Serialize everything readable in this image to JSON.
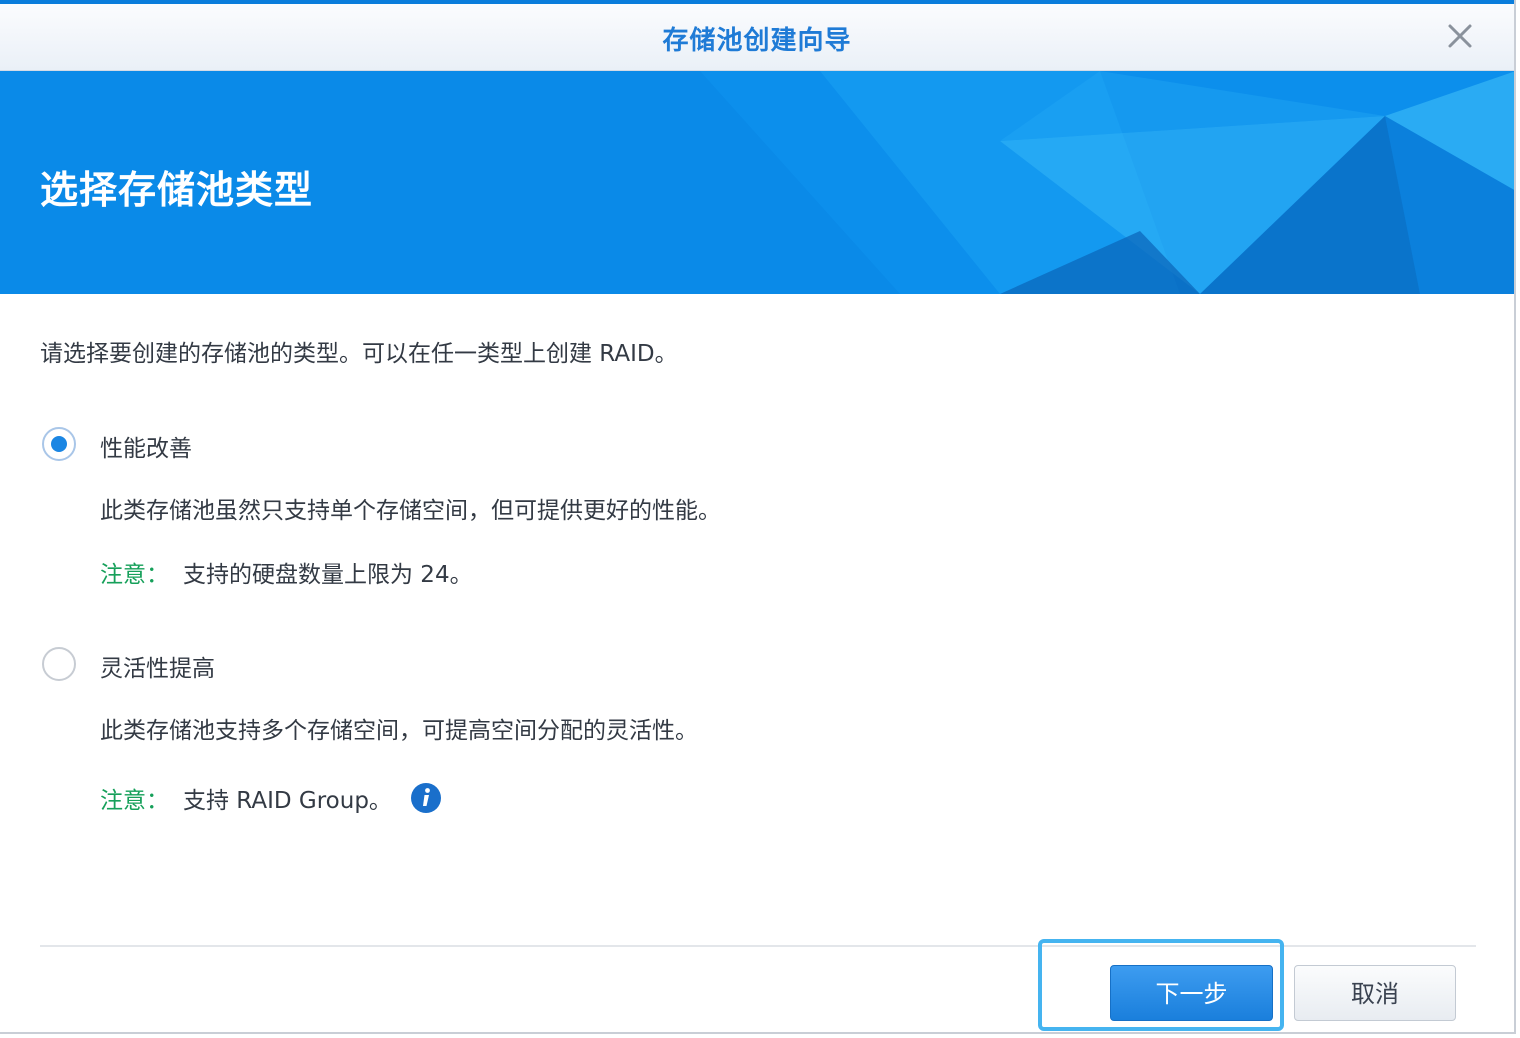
{
  "window": {
    "title": "存储池创建向导",
    "close_icon": "close-icon"
  },
  "banner": {
    "heading": "选择存储池类型"
  },
  "intro_text": "请选择要创建的存储池的类型。可以在任一类型上创建 RAID。",
  "options": [
    {
      "label": "性能改善",
      "selected": true,
      "description": "此类存储池虽然只支持单个存储空间，但可提供更好的性能。",
      "note_label": "注意：",
      "note_text": "支持的硬盘数量上限为 24。"
    },
    {
      "label": "灵活性提高",
      "selected": false,
      "description": "此类存储池支持多个存储空间，可提高空间分配的灵活性。",
      "note_label": "注意：",
      "note_text": "支持 RAID Group。",
      "info_icon": "info-icon"
    }
  ],
  "buttons": {
    "next": "下一步",
    "cancel": "取消"
  },
  "colors": {
    "accent": "#0a8ae8",
    "title": "#1f7bd6",
    "note": "#16a05a"
  }
}
